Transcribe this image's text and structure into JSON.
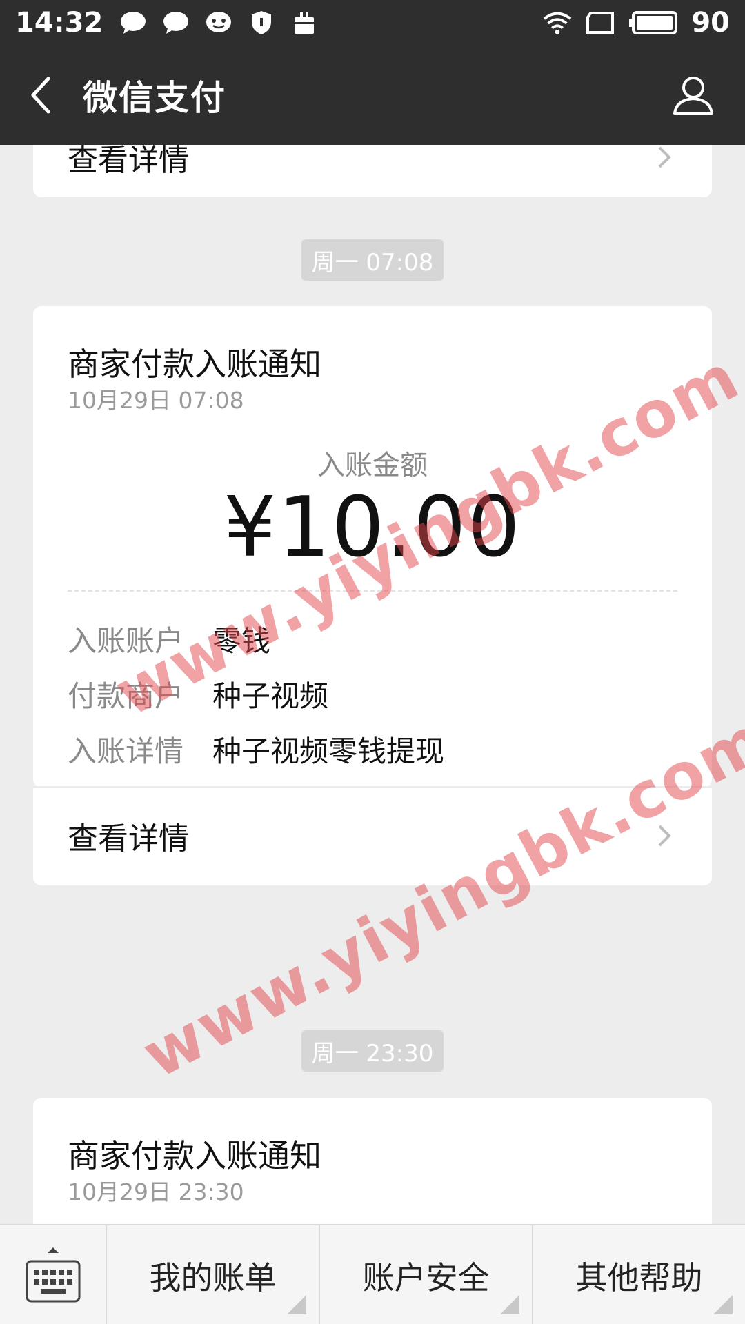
{
  "status_bar": {
    "time": "14:32",
    "battery": "90",
    "left_icons": [
      "chat-bubble-icon",
      "chat-bubble-icon",
      "smiley-icon",
      "shield-icon",
      "briefcase-icon"
    ],
    "right_icons": [
      "wifi-icon",
      "screen-rotate-icon",
      "battery-icon"
    ]
  },
  "header": {
    "title": "微信支付",
    "back_icon": "chevron-left-icon",
    "profile_icon": "user-icon"
  },
  "top_card": {
    "detail_label": "查看详情"
  },
  "messages": [
    {
      "time_chip": "周一 07:08",
      "title": "商家付款入账通知",
      "date": "10月29日  07:08",
      "amount_label": "入账金额",
      "amount": "¥10.00",
      "rows": [
        {
          "key": "入账账户",
          "value": "零钱"
        },
        {
          "key": "付款商户",
          "value": "种子视频"
        },
        {
          "key": "入账详情",
          "value": "种子视频零钱提现"
        }
      ],
      "detail_label": "查看详情"
    },
    {
      "time_chip": "周一 23:30",
      "title": "商家付款入账通知",
      "date": "10月29日  23:30"
    }
  ],
  "watermark": "www.yiyingbk.com",
  "bottom_menu": {
    "keyboard_icon": "keyboard-icon",
    "items": [
      "我的账单",
      "账户安全",
      "其他帮助"
    ]
  },
  "colors": {
    "bar_bg": "#2e2e2e",
    "page_bg": "#ededed",
    "card_bg": "#ffffff",
    "watermark": "#e1464b"
  }
}
